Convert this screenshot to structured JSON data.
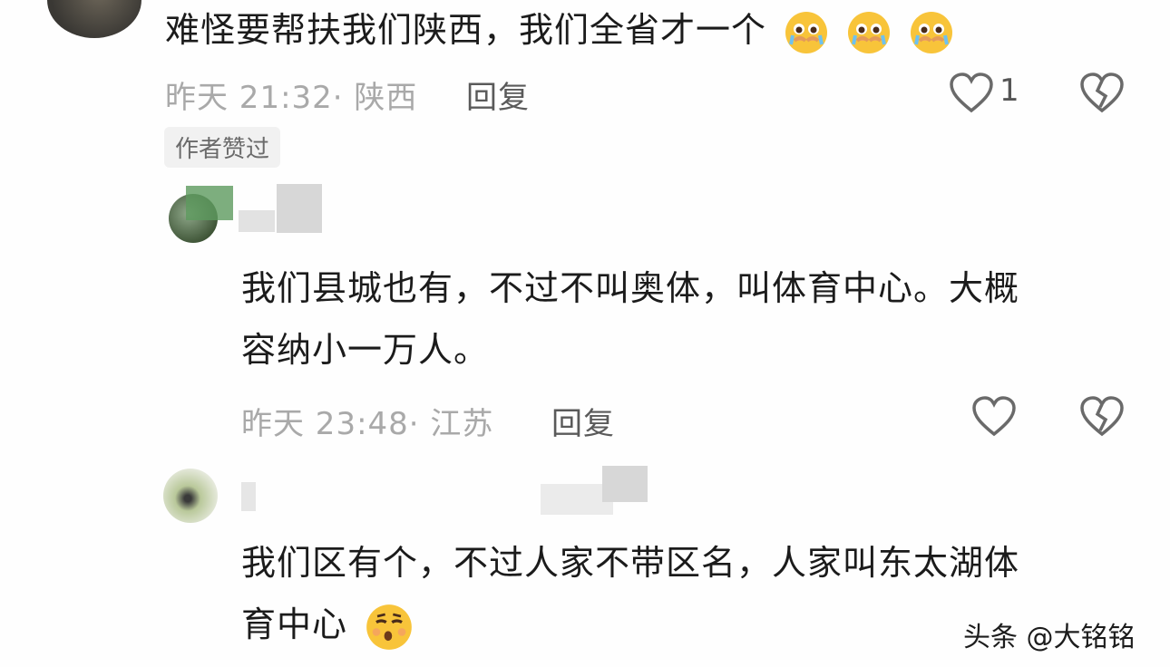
{
  "comment1": {
    "text": "难怪要帮扶我们陕西，我们全省才一个",
    "emoji": [
      "crying-face-emoji",
      "crying-face-emoji",
      "crying-face-emoji"
    ],
    "time": "昨天 21:32",
    "location": "陕西",
    "reply_label": "回复",
    "like_count": "1",
    "author_badge": "作者赞过"
  },
  "reply1": {
    "text_line1": "我们县城也有，不过不叫奥体，叫体育中心。大概",
    "text_line2": "容纳小一万人。",
    "time": "昨天 23:48",
    "location": "江苏",
    "reply_label": "回复"
  },
  "reply2": {
    "text_line1": "我们区有个，不过人家不带区名，人家叫东太湖体",
    "text_line2": "育中心",
    "emoji": "whistling-face-emoji",
    "time": "",
    "location": ""
  },
  "watermark": "头条 @大铭铭",
  "colors": {
    "meta_gray": "#a9a9a9",
    "text": "#1b1b1b",
    "badge_bg": "#f1f1f1"
  }
}
